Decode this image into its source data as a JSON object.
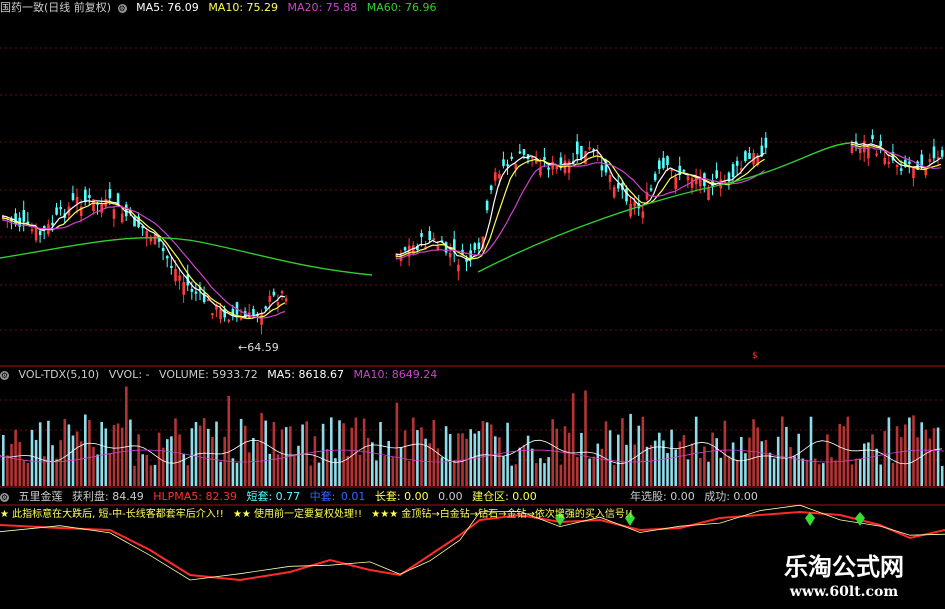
{
  "main": {
    "title": "国药一致(日线 前复权)",
    "ma5_label": "MA5: 76.09",
    "ma10_label": "MA10: 75.29",
    "ma20_label": "MA20: 75.88",
    "ma60_label": "MA60: 76.96",
    "low_marker": "←64.59",
    "colors": {
      "up": "#ff3b3b",
      "down": "#54ffff",
      "ma5": "#ffffff",
      "ma10": "#ffff55",
      "ma20": "#cc44cc",
      "ma60": "#33cc33"
    }
  },
  "volume": {
    "label": "VOL-TDX(5,10)",
    "vvol": "VVOL: -",
    "volume_label": "VOLUME: 5933.72",
    "ma5_label": "MA5: 8618.67",
    "ma10_label": "MA10: 8649.24"
  },
  "indicator": {
    "name": "五里金莲",
    "profit": "获利盘: 84.49",
    "hlpma5": "HLPMA5: 82.39",
    "short": "短套: 0.77",
    "mid_label": "中套:",
    "mid_value": "0.01",
    "long": "长套: 0.00",
    "zero": "0.00",
    "build": "建仓区: 0.00",
    "year_pick": "年选股: 0.00",
    "success": "成功: 0.00",
    "note_1": "★ 此指标意在大跌后, 短-中-长线客都套牢后介入!!",
    "note_2": "★★ 使用前一定要复权处理!!",
    "note_3": "★★★ 金顶钻→白金钻→钻石→金钻→依次增强的买入信号!!"
  },
  "watermark": {
    "name": "乐淘公式网",
    "url": "www.60lt.com"
  }
}
